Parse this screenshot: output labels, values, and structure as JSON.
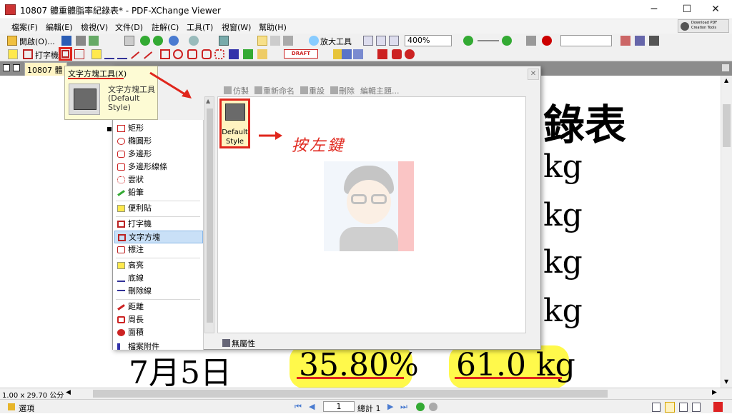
{
  "window": {
    "title": "10807 體重體脂率紀錄表* - PDF-XChange Viewer",
    "minimize": "─",
    "maximize": "☐",
    "close": "✕"
  },
  "menubar": [
    "檔案(F)",
    "編輯(E)",
    "檢視(V)",
    "文件(D)",
    "註解(C)",
    "工具(T)",
    "視窗(W)",
    "幫助(H)"
  ],
  "download_pdf": "Download PDF Creation Tools",
  "toolbar1": {
    "open": "開啟(O)...",
    "zoom_tool": "放大工具",
    "zoom": "400%"
  },
  "toolbar2": {
    "typewriter": "打字機",
    "stamp": "DRAFT"
  },
  "tab": {
    "label": "10807 體重"
  },
  "tooltip": {
    "title": "文字方塊工具(X)",
    "name": "文字方塊工具",
    "style": "(Default Style)"
  },
  "dialog": {
    "toolbar": [
      "仿製",
      "重新命名",
      "重設",
      "刪除",
      "編輯主題..."
    ],
    "style_label": "Default Style",
    "bottom": "無屬性"
  },
  "menu": [
    {
      "label": "矩形",
      "icon": "rectangle-icon"
    },
    {
      "label": "橢圓形",
      "icon": "ellipse-icon"
    },
    {
      "label": "多邊形",
      "icon": "polygon-icon"
    },
    {
      "label": "多邊形線條",
      "icon": "polyline-icon"
    },
    {
      "label": "雲狀",
      "icon": "cloud-icon"
    },
    {
      "label": "鉛筆",
      "icon": "pencil-icon"
    },
    {
      "label": "便利貼",
      "icon": "sticky-note-icon"
    },
    {
      "label": "打字機",
      "icon": "typewriter-icon"
    },
    {
      "label": "文字方塊",
      "icon": "textbox-icon"
    },
    {
      "label": "標注",
      "icon": "callout-icon"
    },
    {
      "label": "高亮",
      "icon": "highlight-icon"
    },
    {
      "label": "底線",
      "icon": "underline-icon"
    },
    {
      "label": "刪除線",
      "icon": "strikeout-icon"
    },
    {
      "label": "距離",
      "icon": "distance-icon"
    },
    {
      "label": "周長",
      "icon": "perimeter-icon"
    },
    {
      "label": "面積",
      "icon": "area-icon"
    },
    {
      "label": "檔案附件",
      "icon": "attachment-icon"
    }
  ],
  "annotation": {
    "text": "按左鍵"
  },
  "document": {
    "heading": "錄表",
    "unit": "kg",
    "date": "7月5日",
    "percent": "35.80%",
    "weight": "61.0 kg"
  },
  "status": {
    "page_size": "1.00 x 29.70 公分",
    "options": "選項",
    "page": "1",
    "total": "總計 1"
  },
  "colors": {
    "accent_red": "#e0261c",
    "highlight": "#fff94b",
    "selected": "#c9e0f7"
  }
}
